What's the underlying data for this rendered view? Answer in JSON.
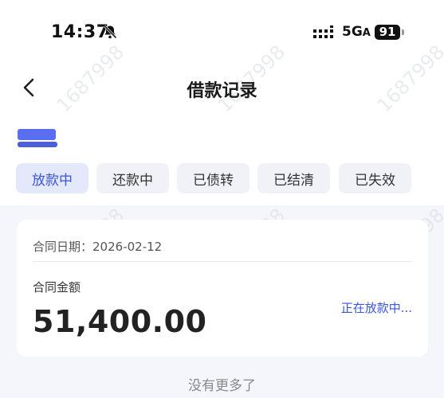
{
  "status_bar": {
    "time": "14:37",
    "network": "5G",
    "network_suffix": "A",
    "battery": "91"
  },
  "header": {
    "title": "借款记录"
  },
  "tabs": [
    {
      "label": "放款中",
      "active": true
    },
    {
      "label": "还款中",
      "active": false
    },
    {
      "label": "已债转",
      "active": false
    },
    {
      "label": "已结清",
      "active": false
    },
    {
      "label": "已失效",
      "active": false
    }
  ],
  "card": {
    "date_label": "合同日期：",
    "date_value": "2026-02-12",
    "amount_label": "合同金额",
    "amount": "51,400.00",
    "status": "正在放款中..."
  },
  "footer": {
    "no_more": "没有更多了"
  },
  "watermark": "1687998",
  "colors": {
    "accent": "#3a55d9",
    "tab_active_bg": "#e3e8fb",
    "tab_bg": "#f0f2f7",
    "page_bg": "#f4f6fb"
  }
}
